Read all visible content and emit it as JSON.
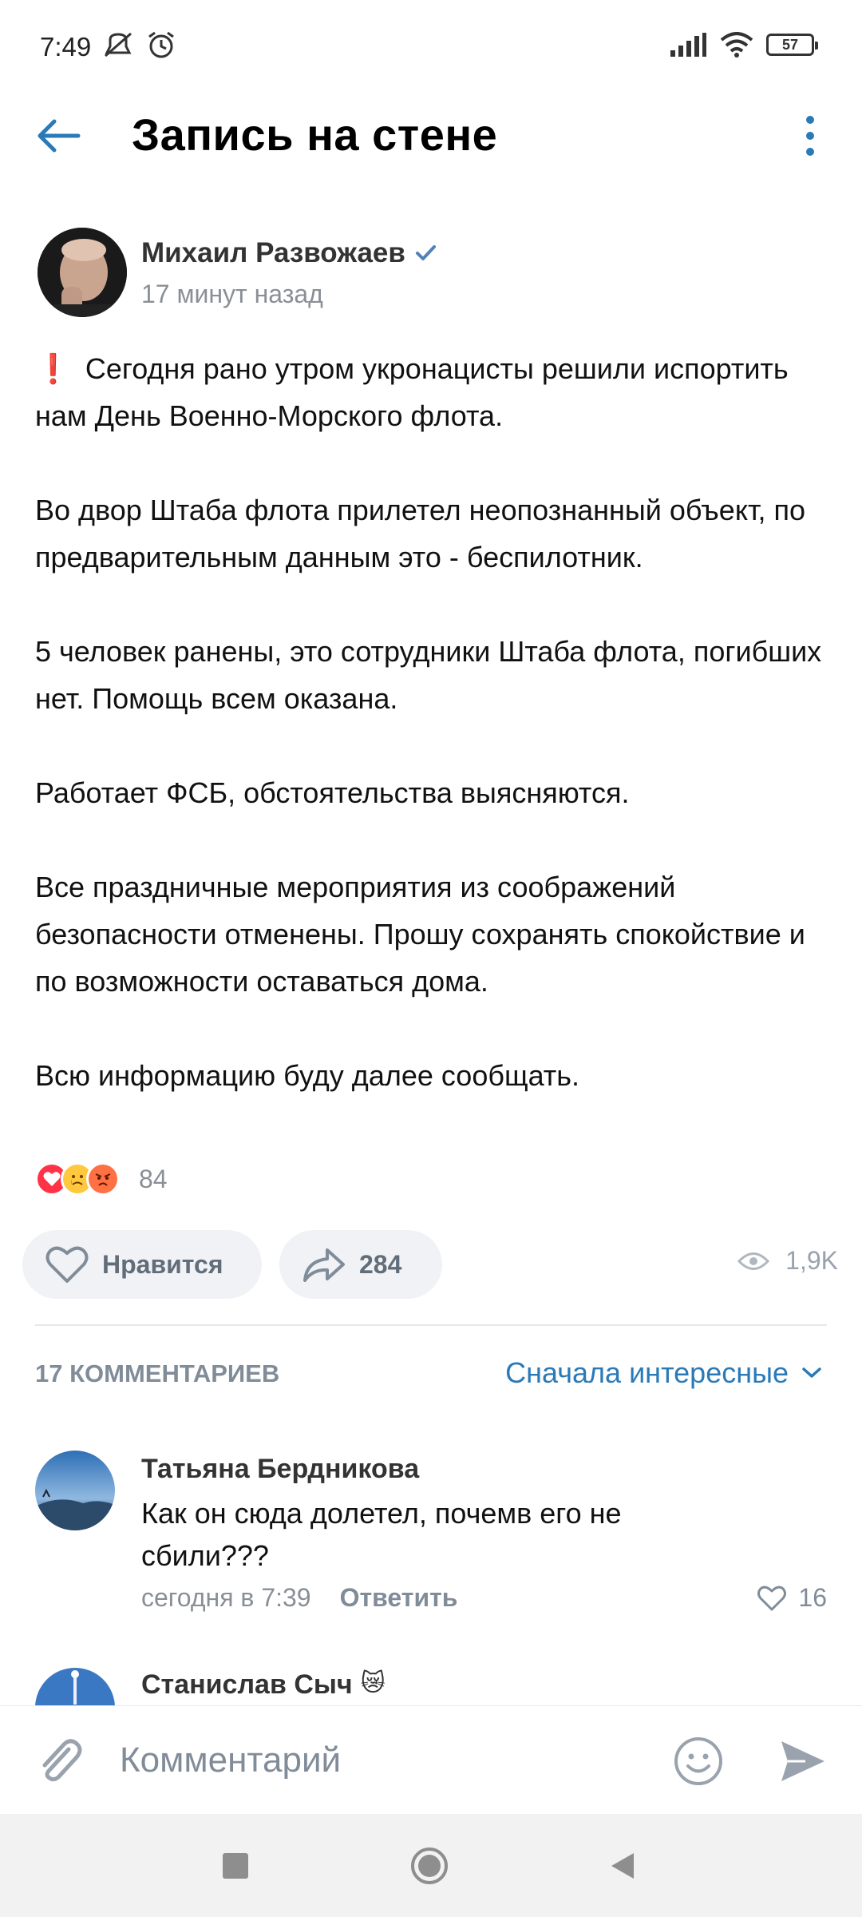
{
  "status_bar": {
    "time": "7:49",
    "battery": "57"
  },
  "header": {
    "title": "Запись на стене"
  },
  "post": {
    "author": "Михаил Развожаев",
    "time": "17 минут назад",
    "paragraphs": [
      "Сегодня рано утром укронацисты решили испортить нам День Военно-Морского флота.",
      "Во двор Штаба флота прилетел неопознанный объект, по предварительным данным это - беспилотник.",
      "5 человек ранены, это сотрудники Штаба флота, погибших нет. Помощь всем оказана.",
      "Работает ФСБ, обстоятельства выясняются.",
      "Все праздничные мероприятия из соображений безопасности отменены. Прошу сохранять спокойствие и по возможности оставаться дома.",
      "Всю информацию буду далее сообщать."
    ],
    "warning_mark": "❗",
    "reactions": {
      "count": "84"
    },
    "like_label": "Нравится",
    "shares": "284",
    "views": "1,9K"
  },
  "comments_section": {
    "count_label": "17 КОММЕНТАРИЕВ",
    "sort_label": "Сначала интересные",
    "items": [
      {
        "author": "Татьяна Бердникова",
        "text": "Как  он сюда долетел, почемв его не сбили???",
        "time": "сегодня в 7:39",
        "reply_label": "Ответить",
        "likes": "16"
      },
      {
        "author": "Станислав Сыч",
        "emoji": "😿"
      }
    ]
  },
  "input": {
    "placeholder": "Комментарий"
  },
  "colors": {
    "accent": "#2a7ab8",
    "secondary": "#818c99",
    "warning": "#e0213a"
  }
}
